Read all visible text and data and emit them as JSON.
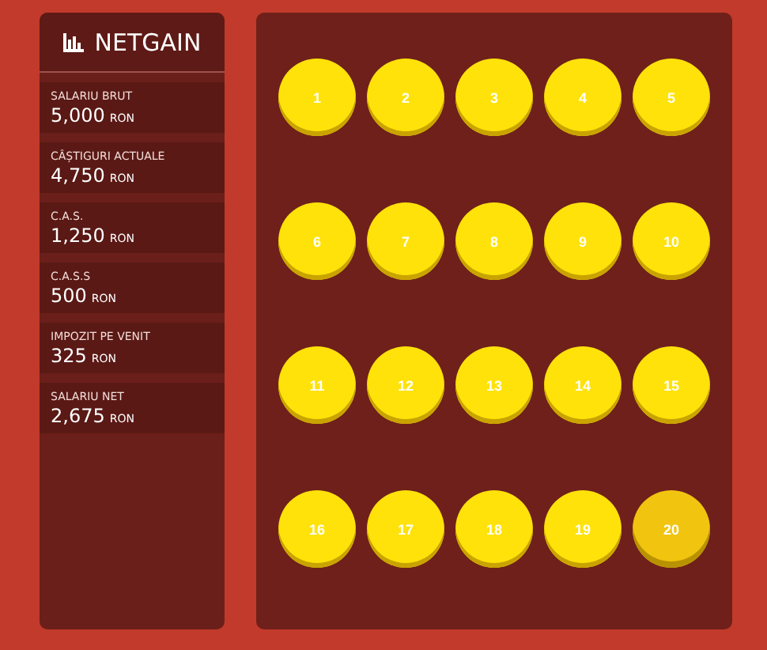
{
  "brand": {
    "title": "NETGAIN"
  },
  "stats": [
    {
      "label": "SALARIU BRUT",
      "value": "5,000",
      "unit": "RON"
    },
    {
      "label": "CÂȘTIGURI ACTUALE",
      "value": "4,750",
      "unit": "RON"
    },
    {
      "label": "C.A.S.",
      "value": "1,250",
      "unit": "RON"
    },
    {
      "label": "C.A.S.S",
      "value": "500",
      "unit": "RON"
    },
    {
      "label": "IMPOZIT PE VENIT",
      "value": "325",
      "unit": "RON"
    },
    {
      "label": "SALARIU NET",
      "value": "2,675",
      "unit": "RON"
    }
  ],
  "coins": [
    {
      "label": "1",
      "selected": false
    },
    {
      "label": "2",
      "selected": false
    },
    {
      "label": "3",
      "selected": false
    },
    {
      "label": "4",
      "selected": false
    },
    {
      "label": "5",
      "selected": false
    },
    {
      "label": "6",
      "selected": false
    },
    {
      "label": "7",
      "selected": false
    },
    {
      "label": "8",
      "selected": false
    },
    {
      "label": "9",
      "selected": false
    },
    {
      "label": "10",
      "selected": false
    },
    {
      "label": "11",
      "selected": false
    },
    {
      "label": "12",
      "selected": false
    },
    {
      "label": "13",
      "selected": false
    },
    {
      "label": "14",
      "selected": false
    },
    {
      "label": "15",
      "selected": false
    },
    {
      "label": "16",
      "selected": false
    },
    {
      "label": "17",
      "selected": false
    },
    {
      "label": "18",
      "selected": false
    },
    {
      "label": "19",
      "selected": false
    },
    {
      "label": "20",
      "selected": true
    }
  ]
}
